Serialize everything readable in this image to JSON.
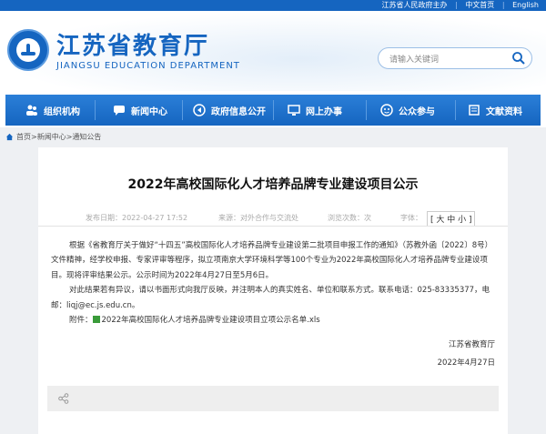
{
  "topbar": {
    "links": [
      "江苏省人民政府主办",
      "中文首页",
      "English"
    ]
  },
  "header": {
    "title_cn": "江苏省教育厅",
    "title_en": "JIANGSU EDUCATION DEPARTMENT",
    "search_placeholder": "请输入关键词"
  },
  "nav": {
    "items": [
      {
        "label": "组织机构",
        "icon": "people-icon"
      },
      {
        "label": "新闻中心",
        "icon": "chat-icon"
      },
      {
        "label": "政府信息公开",
        "icon": "info-icon"
      },
      {
        "label": "网上办事",
        "icon": "monitor-icon"
      },
      {
        "label": "公众参与",
        "icon": "public-icon"
      },
      {
        "label": "文献资料",
        "icon": "document-icon"
      }
    ]
  },
  "breadcrumb": {
    "home": "首页",
    "section": "新闻中心",
    "page": "通知公告"
  },
  "article": {
    "title": "2022年高校国际化人才培养品牌专业建设项目公示",
    "publish_time": "发布日期：2022-04-27 17:52",
    "source": "来源：对外合作与交流处",
    "views": "浏览次数：次",
    "font_size_label": "字体：",
    "font_sizes": "[ 大 中 小 ]",
    "para1": "根据《省教育厅关于做好“十四五”高校国际化人才培养品牌专业建设第二批项目申报工作的通知》（苏教外函〔2022〕8号）文件精神，经学校申报、专家评审等程序，拟立项南京大学环境科学等100个专业为2022年高校国际化人才培养品牌专业建设项目。现将评审结果公示。公示时间为2022年4月27日至5月6日。",
    "para2": "对此结果若有异议，请以书面形式向我厅反映，并注明本人的真实姓名、单位和联系方式。联系电话：025-83335377，电邮：liqj@ec.js.edu.cn。",
    "attachment_label": "附件：",
    "attachment_name": "2022年高校国际化人才培养品牌专业建设项目立项公示名单.xls",
    "signature": "江苏省教育厅",
    "date": "2022年4月27日"
  },
  "colors": {
    "brand": "#1565c0",
    "nav": "#2b7fd8",
    "background": "#eef0f3"
  }
}
